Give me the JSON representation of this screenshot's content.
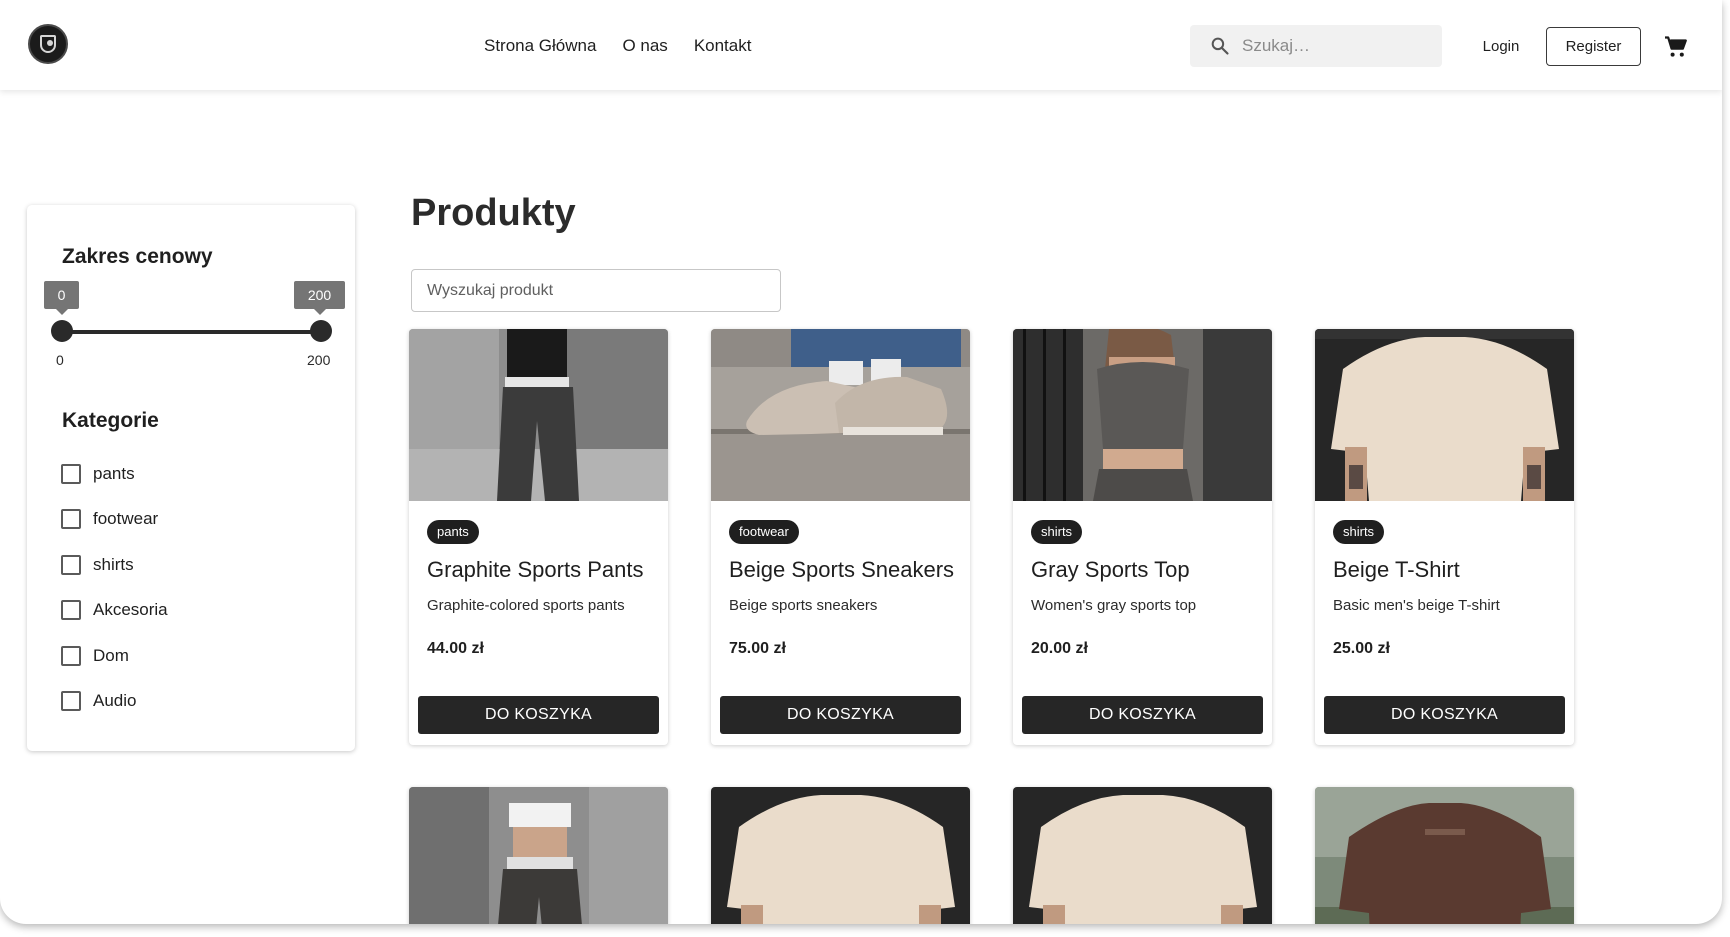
{
  "header": {
    "nav": [
      "Strona Główna",
      "O nas",
      "Kontakt"
    ],
    "search_placeholder": "Szukaj…",
    "login_label": "Login",
    "register_label": "Register",
    "cart_icon": "shopping-cart-icon"
  },
  "filters": {
    "price_title": "Zakres cenowy",
    "price_min": "0",
    "price_max": "200",
    "range_min": "0",
    "range_max": "200",
    "category_title": "Kategorie",
    "categories": [
      "pants",
      "footwear",
      "shirts",
      "Akcesoria",
      "Dom",
      "Audio"
    ]
  },
  "main": {
    "title": "Produkty",
    "search_placeholder": "Wyszukaj produkt",
    "add_to_cart_label": "DO KOSZYKA",
    "products": [
      {
        "category": "pants",
        "name": "Graphite Sports Pants",
        "description": "Graphite-colored sports pants",
        "price": "44.00 zł"
      },
      {
        "category": "footwear",
        "name": "Beige Sports Sneakers",
        "description": "Beige sports sneakers",
        "price": "75.00 zł"
      },
      {
        "category": "shirts",
        "name": "Gray Sports Top",
        "description": "Women's gray sports top",
        "price": "20.00 zł"
      },
      {
        "category": "shirts",
        "name": "Beige T-Shirt",
        "description": "Basic men's beige T-shirt",
        "price": "25.00 zł"
      }
    ]
  },
  "colors": {
    "primary_button": "#262626",
    "badge": "#1f1f1f",
    "slider": "#2a2a2a",
    "slider_chip": "#757575"
  }
}
